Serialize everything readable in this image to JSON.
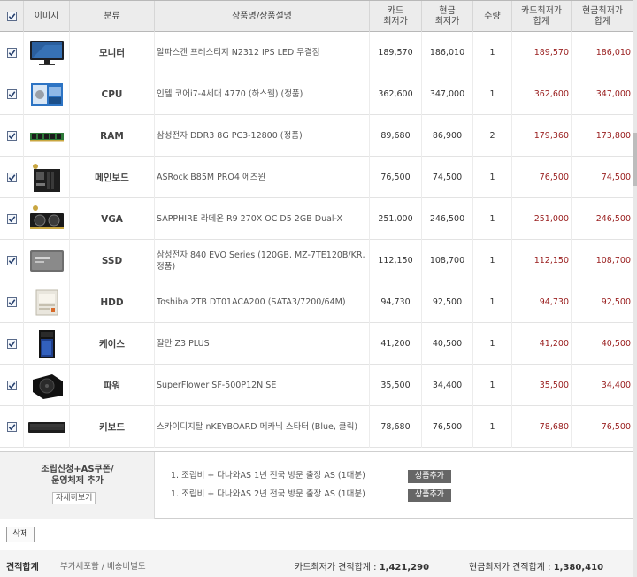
{
  "header": {
    "image": "이미지",
    "category": "분류",
    "name": "상품명/상품설명",
    "card_line1": "카드",
    "card_line2": "최저가",
    "cash_line1": "현금",
    "cash_line2": "최저가",
    "qty": "수량",
    "cardsum_line1": "카드최저가",
    "cardsum_line2": "합계",
    "cashsum_line1": "현금최저가",
    "cashsum_line2": "합계"
  },
  "rows": [
    {
      "category": "모니터",
      "name": "알파스캔 프레스티지 N2312 IPS LED 무결점",
      "card": "189,570",
      "cash": "186,010",
      "qty": "1",
      "card_sum": "189,570",
      "cash_sum": "186,010",
      "icon": "monitor-icon"
    },
    {
      "category": "CPU",
      "name": "인텔 코어i7-4세대 4770 (하스웰) (정품)",
      "card": "362,600",
      "cash": "347,000",
      "qty": "1",
      "card_sum": "362,600",
      "cash_sum": "347,000",
      "icon": "cpu-icon"
    },
    {
      "category": "RAM",
      "name": "삼성전자 DDR3 8G PC3-12800 (정품)",
      "card": "89,680",
      "cash": "86,900",
      "qty": "2",
      "card_sum": "179,360",
      "cash_sum": "173,800",
      "icon": "ram-icon"
    },
    {
      "category": "메인보드",
      "name": "ASRock B85M PRO4 에즈윈",
      "card": "76,500",
      "cash": "74,500",
      "qty": "1",
      "card_sum": "76,500",
      "cash_sum": "74,500",
      "icon": "motherboard-icon"
    },
    {
      "category": "VGA",
      "name": "SAPPHIRE 라데온 R9 270X OC D5 2GB Dual-X",
      "card": "251,000",
      "cash": "246,500",
      "qty": "1",
      "card_sum": "251,000",
      "cash_sum": "246,500",
      "icon": "graphics-card-icon"
    },
    {
      "category": "SSD",
      "name": "삼성전자 840 EVO Series (120GB, MZ-7TE120B/KR, 정품)",
      "card": "112,150",
      "cash": "108,700",
      "qty": "1",
      "card_sum": "112,150",
      "cash_sum": "108,700",
      "icon": "ssd-icon"
    },
    {
      "category": "HDD",
      "name": "Toshiba 2TB DT01ACA200 (SATA3/7200/64M)",
      "card": "94,730",
      "cash": "92,500",
      "qty": "1",
      "card_sum": "94,730",
      "cash_sum": "92,500",
      "icon": "hdd-icon"
    },
    {
      "category": "케이스",
      "name": "잘만 Z3 PLUS",
      "card": "41,200",
      "cash": "40,500",
      "qty": "1",
      "card_sum": "41,200",
      "cash_sum": "40,500",
      "icon": "case-icon"
    },
    {
      "category": "파워",
      "name": "SuperFlower SF-500P12N SE",
      "card": "35,500",
      "cash": "34,400",
      "qty": "1",
      "card_sum": "35,500",
      "cash_sum": "34,400",
      "icon": "power-supply-icon"
    },
    {
      "category": "키보드",
      "name": "스카이디지탈 nKEYBOARD 메카닉 스타터 (Blue, 클릭)",
      "card": "78,680",
      "cash": "76,500",
      "qty": "1",
      "card_sum": "78,680",
      "cash_sum": "76,500",
      "icon": "keyboard-icon"
    }
  ],
  "assembly": {
    "title_line1": "조립신청+AS쿠폰/",
    "title_line2": "운영체제 추가",
    "detail_button": "자세히보기",
    "options": [
      {
        "label": "1. 조립비 + 다나와AS 1년 전국 방문 출장 AS (1대분)",
        "button": "상품추가"
      },
      {
        "label": "1. 조립비 + 다나와AS 2년 전국 방문 출장 AS (1대분)",
        "button": "상품추가"
      }
    ]
  },
  "delete_button": "삭제",
  "totals": {
    "label": "견적합계",
    "links": "부가세포함 / 배송비별도",
    "card_label": "카드최저가 견적합계 : ",
    "card_value": "1,421,290",
    "cash_label": "현금최저가 견적합계 : ",
    "cash_value": "1,380,410"
  },
  "colors": {
    "sum_red": "#9a2020",
    "header_bg": "#ececec"
  }
}
